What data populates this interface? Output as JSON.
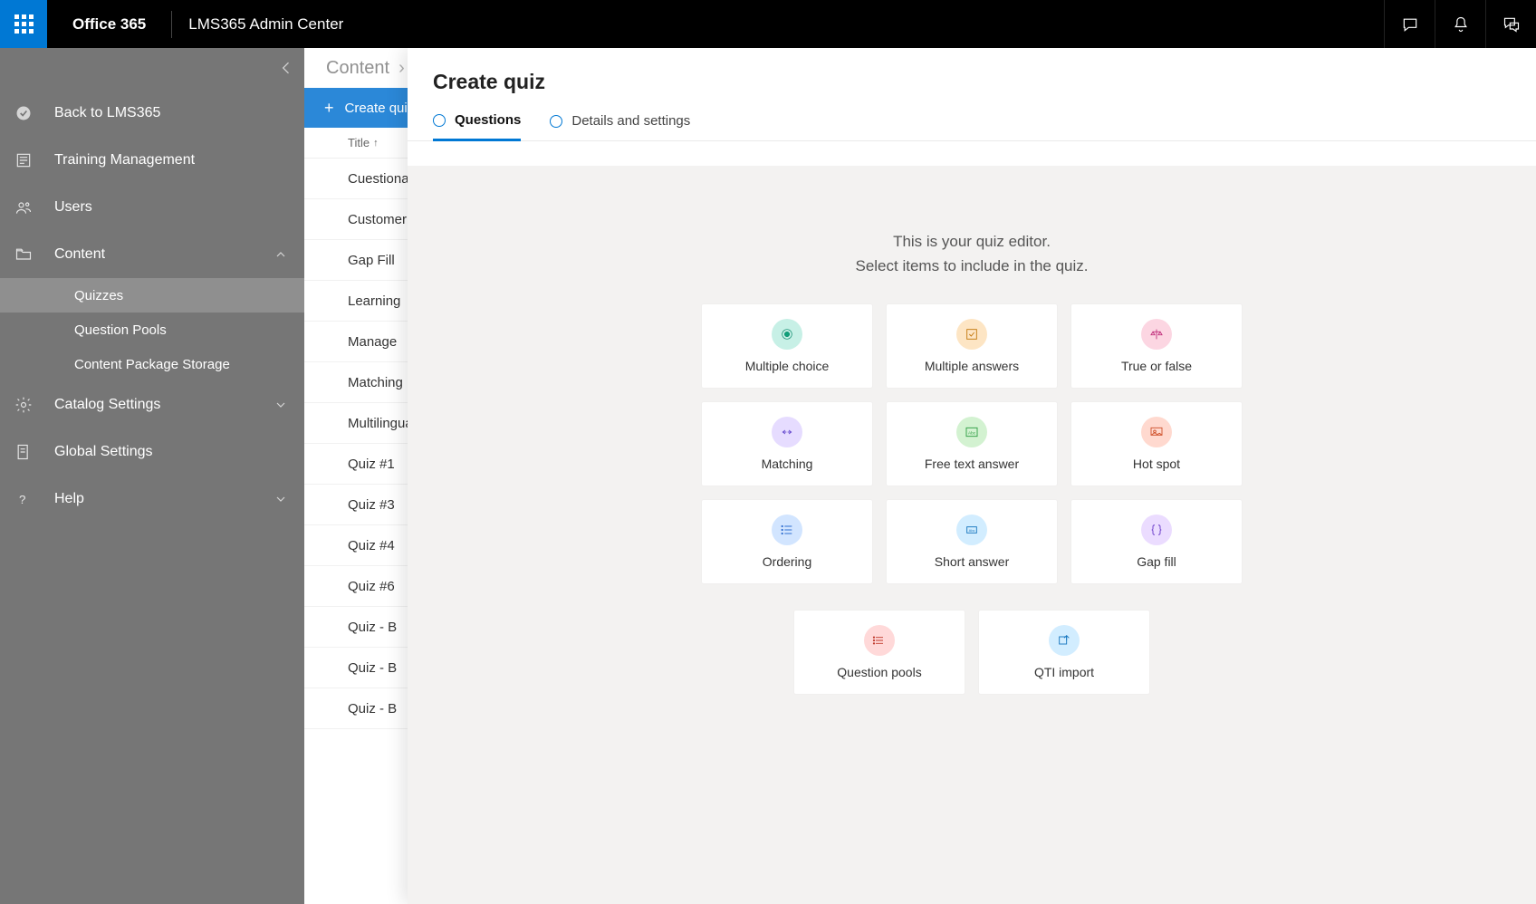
{
  "topbar": {
    "brand": "Office 365",
    "app_title": "LMS365 Admin Center"
  },
  "sidenav": {
    "items": [
      {
        "label": "Back to LMS365"
      },
      {
        "label": "Training Management"
      },
      {
        "label": "Users"
      },
      {
        "label": "Content",
        "expanded": true,
        "children": [
          {
            "label": "Quizzes",
            "active": true
          },
          {
            "label": "Question Pools"
          },
          {
            "label": "Content Package Storage"
          }
        ]
      },
      {
        "label": "Catalog Settings",
        "expandable": true
      },
      {
        "label": "Global Settings"
      },
      {
        "label": "Help",
        "expandable": true
      }
    ]
  },
  "listpane": {
    "breadcrumb": "Content",
    "create_label": "Create quiz",
    "column_header": "Title",
    "items": [
      "Cuestionario",
      "Customer",
      "Gap Fill",
      "Learning",
      "Manage",
      "Matching",
      "Multilingual",
      "Quiz #1",
      "Quiz #3",
      "Quiz #4",
      "Quiz #6",
      "Quiz - B",
      "Quiz - B",
      "Quiz - B"
    ]
  },
  "panel": {
    "title": "Create quiz",
    "tabs": {
      "questions": "Questions",
      "details": "Details and settings"
    },
    "intro_line1": "This is your quiz editor.",
    "intro_line2": "Select items to include in the quiz.",
    "cards": [
      {
        "label": "Multiple choice",
        "icon": "radio-dot",
        "theme": "teal"
      },
      {
        "label": "Multiple answers",
        "icon": "check-box",
        "theme": "orange"
      },
      {
        "label": "True or false",
        "icon": "scale",
        "theme": "pink"
      },
      {
        "label": "Matching",
        "icon": "swap",
        "theme": "lilac"
      },
      {
        "label": "Free text answer",
        "icon": "abc-box",
        "theme": "green"
      },
      {
        "label": "Hot spot",
        "icon": "image-spot",
        "theme": "coral"
      },
      {
        "label": "Ordering",
        "icon": "list",
        "theme": "blue"
      },
      {
        "label": "Short answer",
        "icon": "abc-single",
        "theme": "sky"
      },
      {
        "label": "Gap fill",
        "icon": "braces",
        "theme": "violet"
      }
    ],
    "cards2": [
      {
        "label": "Question pools",
        "icon": "pool-icon",
        "theme": "red"
      },
      {
        "label": "QTI import",
        "icon": "qti-import",
        "theme": "sky"
      }
    ]
  }
}
